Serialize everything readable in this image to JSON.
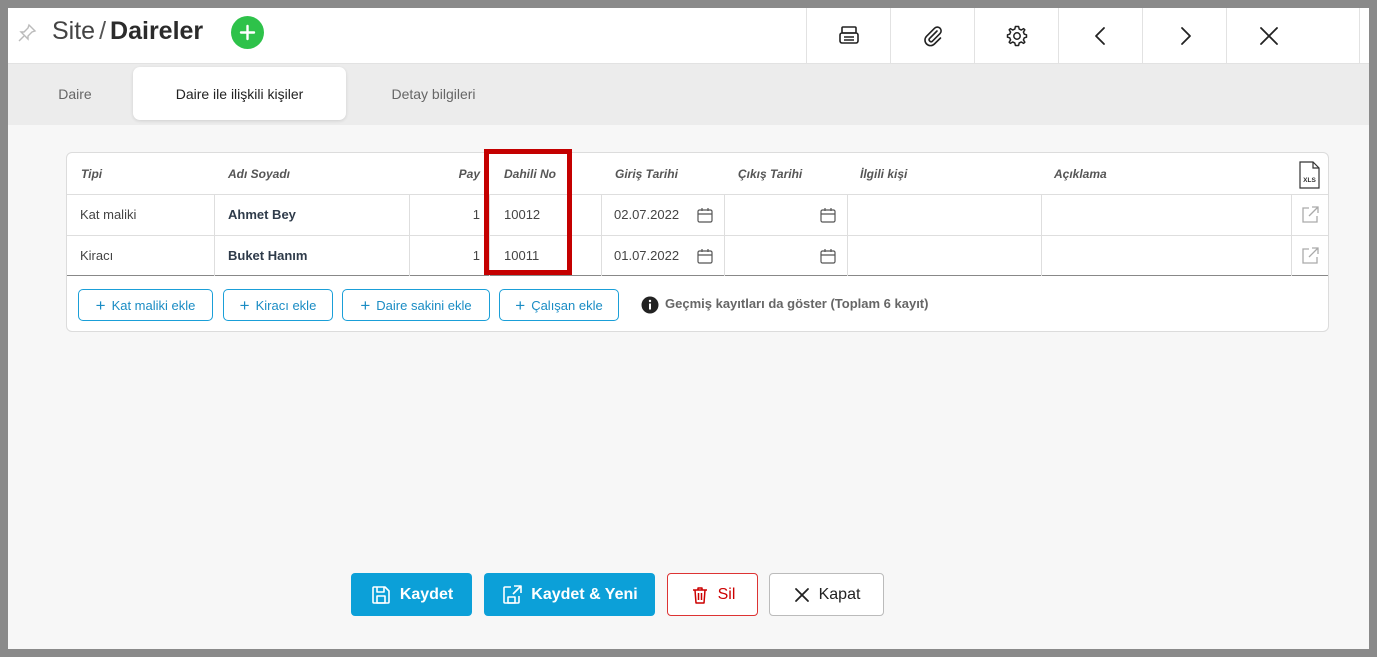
{
  "header": {
    "breadcrumb_parent": "Site",
    "breadcrumb_sep": "/",
    "breadcrumb_current": "Daireler",
    "add_icon": "plus-icon",
    "pin_icon": "pin-icon",
    "tools": [
      {
        "icon": "print-icon"
      },
      {
        "icon": "paperclip-icon"
      },
      {
        "icon": "gear-icon"
      },
      {
        "icon": "chevron-left-icon"
      },
      {
        "icon": "chevron-right-icon"
      },
      {
        "icon": "close-icon"
      }
    ]
  },
  "tabs": [
    {
      "label": "Daire"
    },
    {
      "label": "Daire ile ilişkili kişiler",
      "active": true
    },
    {
      "label": "Detay bilgileri"
    }
  ],
  "table": {
    "headers": {
      "tipi": "Tipi",
      "adi_soyadi": "Adı Soyadı",
      "pay": "Pay",
      "dahili_no": "Dahili No",
      "giris_tarihi": "Giriş Tarihi",
      "cikis_tarihi": "Çıkış Tarihi",
      "ilgili_kisi": "İlgili kişi",
      "aciklama": "Açıklama"
    },
    "export_icon": "xls-file-icon",
    "rows": [
      {
        "tipi": "Kat maliki",
        "adi_soyadi": "Ahmet Bey",
        "pay": "1",
        "dahili_no": "10012",
        "giris_tarihi": "02.07.2022",
        "cikis_tarihi": "",
        "ilgili_kisi": "",
        "aciklama": ""
      },
      {
        "tipi": "Kiracı",
        "adi_soyadi": "Buket Hanım",
        "pay": "1",
        "dahili_no": "10011",
        "giris_tarihi": "01.07.2022",
        "cikis_tarihi": "",
        "ilgili_kisi": "",
        "aciklama": ""
      }
    ]
  },
  "actions": {
    "kat_maliki_ekle": "Kat maliki ekle",
    "kiraci_ekle": "Kiracı ekle",
    "daire_sakini_ekle": "Daire sakini ekle",
    "calisan_ekle": "Çalışan ekle",
    "gecmis": "Geçmiş kayıtları da göster (Toplam 6 kayıt)"
  },
  "footer": {
    "kaydet": "Kaydet",
    "kaydet_yeni": "Kaydet & Yeni",
    "sil": "Sil",
    "kapat": "Kapat"
  },
  "colors": {
    "accent": "#0ca0d8",
    "add_green": "#2ec24a",
    "highlight_red": "#c40000",
    "danger": "#cc0000"
  }
}
